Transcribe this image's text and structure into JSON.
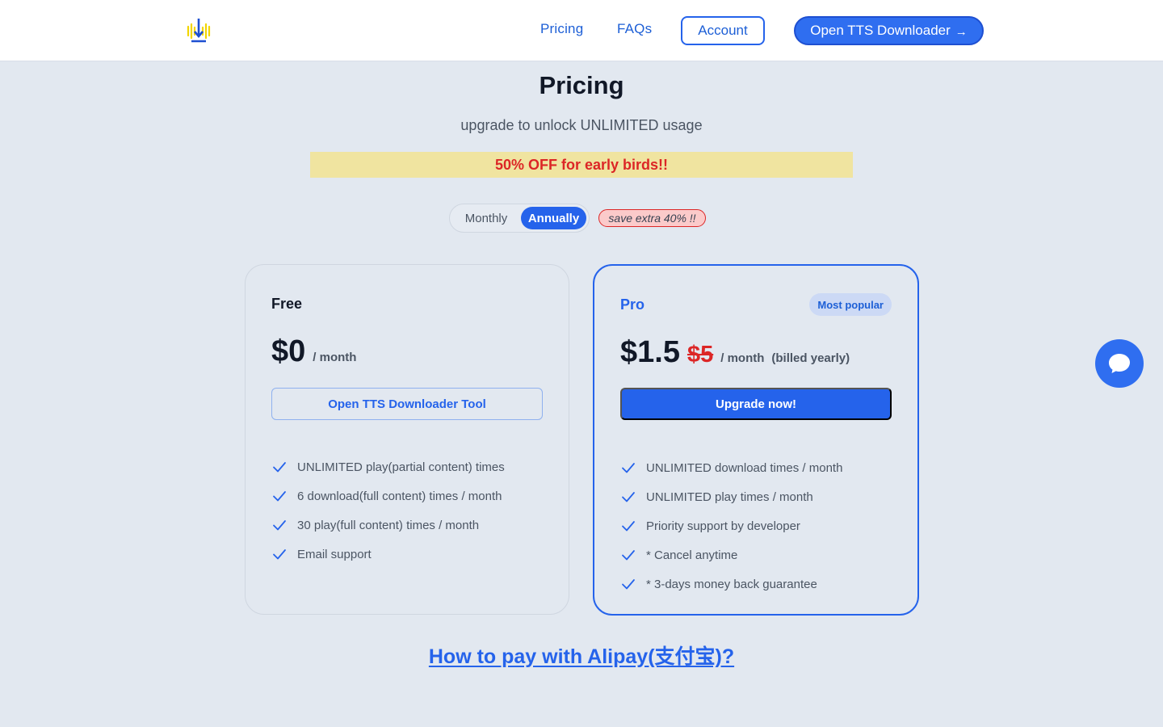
{
  "header": {
    "nav": {
      "pricing": "Pricing",
      "faqs": "FAQs"
    },
    "account": "Account",
    "open_app": "Open TTS Downloader",
    "open_app_arrow": "→"
  },
  "hero": {
    "title": "Pricing",
    "subtitle": "upgrade to unlock UNLIMITED usage",
    "promo": "50% OFF for early birds!!"
  },
  "billing_toggle": {
    "monthly": "Monthly",
    "annually": "Annually",
    "selected": "Annually",
    "save_badge": "save extra 40% !!"
  },
  "plans": {
    "free": {
      "name": "Free",
      "price": "$0",
      "period": "/ month",
      "cta": "Open TTS Downloader Tool",
      "features": [
        "UNLIMITED play(partial content) times",
        "6 download(full content) times / month",
        "30 play(full content) times / month",
        "Email support"
      ]
    },
    "pro": {
      "name": "Pro",
      "badge": "Most popular",
      "price": "$1.5",
      "old_price": "$5",
      "period": "/ month",
      "billing_note": "(billed yearly)",
      "cta": "Upgrade now!",
      "features": [
        "UNLIMITED download times / month",
        "UNLIMITED play times / month",
        "Priority support by developer",
        "* Cancel anytime",
        "* 3-days money back guarantee"
      ]
    }
  },
  "footer": {
    "alipay_link": "How to pay with Alipay(支付宝)?"
  },
  "icons": {
    "logo": "download-waveform-logo",
    "check": "check-icon",
    "chat": "chat-bubble-icon"
  },
  "colors": {
    "primary": "#2563eb",
    "promo_bg": "#f0e4a0",
    "promo_text": "#dc2626",
    "page_bg": "#e2e8f0"
  }
}
